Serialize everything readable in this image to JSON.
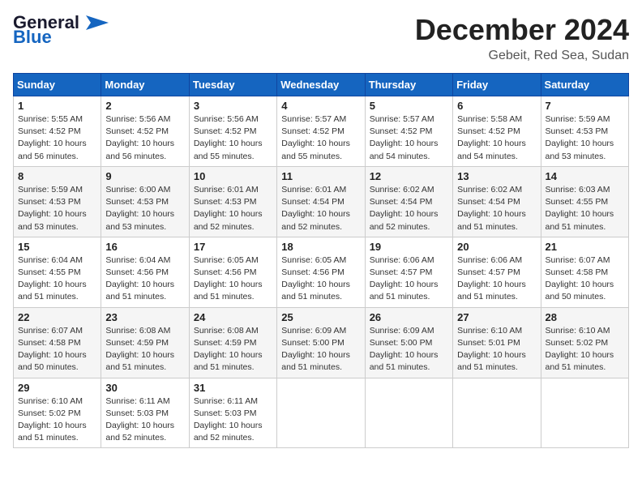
{
  "header": {
    "logo_line1": "General",
    "logo_line2": "Blue",
    "main_title": "December 2024",
    "subtitle": "Gebeit, Red Sea, Sudan"
  },
  "days_of_week": [
    "Sunday",
    "Monday",
    "Tuesday",
    "Wednesday",
    "Thursday",
    "Friday",
    "Saturday"
  ],
  "weeks": [
    [
      {
        "day": "1",
        "detail": "Sunrise: 5:55 AM\nSunset: 4:52 PM\nDaylight: 10 hours\nand 56 minutes."
      },
      {
        "day": "2",
        "detail": "Sunrise: 5:56 AM\nSunset: 4:52 PM\nDaylight: 10 hours\nand 56 minutes."
      },
      {
        "day": "3",
        "detail": "Sunrise: 5:56 AM\nSunset: 4:52 PM\nDaylight: 10 hours\nand 55 minutes."
      },
      {
        "day": "4",
        "detail": "Sunrise: 5:57 AM\nSunset: 4:52 PM\nDaylight: 10 hours\nand 55 minutes."
      },
      {
        "day": "5",
        "detail": "Sunrise: 5:57 AM\nSunset: 4:52 PM\nDaylight: 10 hours\nand 54 minutes."
      },
      {
        "day": "6",
        "detail": "Sunrise: 5:58 AM\nSunset: 4:52 PM\nDaylight: 10 hours\nand 54 minutes."
      },
      {
        "day": "7",
        "detail": "Sunrise: 5:59 AM\nSunset: 4:53 PM\nDaylight: 10 hours\nand 53 minutes."
      }
    ],
    [
      {
        "day": "8",
        "detail": "Sunrise: 5:59 AM\nSunset: 4:53 PM\nDaylight: 10 hours\nand 53 minutes."
      },
      {
        "day": "9",
        "detail": "Sunrise: 6:00 AM\nSunset: 4:53 PM\nDaylight: 10 hours\nand 53 minutes."
      },
      {
        "day": "10",
        "detail": "Sunrise: 6:01 AM\nSunset: 4:53 PM\nDaylight: 10 hours\nand 52 minutes."
      },
      {
        "day": "11",
        "detail": "Sunrise: 6:01 AM\nSunset: 4:54 PM\nDaylight: 10 hours\nand 52 minutes."
      },
      {
        "day": "12",
        "detail": "Sunrise: 6:02 AM\nSunset: 4:54 PM\nDaylight: 10 hours\nand 52 minutes."
      },
      {
        "day": "13",
        "detail": "Sunrise: 6:02 AM\nSunset: 4:54 PM\nDaylight: 10 hours\nand 51 minutes."
      },
      {
        "day": "14",
        "detail": "Sunrise: 6:03 AM\nSunset: 4:55 PM\nDaylight: 10 hours\nand 51 minutes."
      }
    ],
    [
      {
        "day": "15",
        "detail": "Sunrise: 6:04 AM\nSunset: 4:55 PM\nDaylight: 10 hours\nand 51 minutes."
      },
      {
        "day": "16",
        "detail": "Sunrise: 6:04 AM\nSunset: 4:56 PM\nDaylight: 10 hours\nand 51 minutes."
      },
      {
        "day": "17",
        "detail": "Sunrise: 6:05 AM\nSunset: 4:56 PM\nDaylight: 10 hours\nand 51 minutes."
      },
      {
        "day": "18",
        "detail": "Sunrise: 6:05 AM\nSunset: 4:56 PM\nDaylight: 10 hours\nand 51 minutes."
      },
      {
        "day": "19",
        "detail": "Sunrise: 6:06 AM\nSunset: 4:57 PM\nDaylight: 10 hours\nand 51 minutes."
      },
      {
        "day": "20",
        "detail": "Sunrise: 6:06 AM\nSunset: 4:57 PM\nDaylight: 10 hours\nand 51 minutes."
      },
      {
        "day": "21",
        "detail": "Sunrise: 6:07 AM\nSunset: 4:58 PM\nDaylight: 10 hours\nand 50 minutes."
      }
    ],
    [
      {
        "day": "22",
        "detail": "Sunrise: 6:07 AM\nSunset: 4:58 PM\nDaylight: 10 hours\nand 50 minutes."
      },
      {
        "day": "23",
        "detail": "Sunrise: 6:08 AM\nSunset: 4:59 PM\nDaylight: 10 hours\nand 51 minutes."
      },
      {
        "day": "24",
        "detail": "Sunrise: 6:08 AM\nSunset: 4:59 PM\nDaylight: 10 hours\nand 51 minutes."
      },
      {
        "day": "25",
        "detail": "Sunrise: 6:09 AM\nSunset: 5:00 PM\nDaylight: 10 hours\nand 51 minutes."
      },
      {
        "day": "26",
        "detail": "Sunrise: 6:09 AM\nSunset: 5:00 PM\nDaylight: 10 hours\nand 51 minutes."
      },
      {
        "day": "27",
        "detail": "Sunrise: 6:10 AM\nSunset: 5:01 PM\nDaylight: 10 hours\nand 51 minutes."
      },
      {
        "day": "28",
        "detail": "Sunrise: 6:10 AM\nSunset: 5:02 PM\nDaylight: 10 hours\nand 51 minutes."
      }
    ],
    [
      {
        "day": "29",
        "detail": "Sunrise: 6:10 AM\nSunset: 5:02 PM\nDaylight: 10 hours\nand 51 minutes."
      },
      {
        "day": "30",
        "detail": "Sunrise: 6:11 AM\nSunset: 5:03 PM\nDaylight: 10 hours\nand 52 minutes."
      },
      {
        "day": "31",
        "detail": "Sunrise: 6:11 AM\nSunset: 5:03 PM\nDaylight: 10 hours\nand 52 minutes."
      },
      null,
      null,
      null,
      null
    ]
  ]
}
